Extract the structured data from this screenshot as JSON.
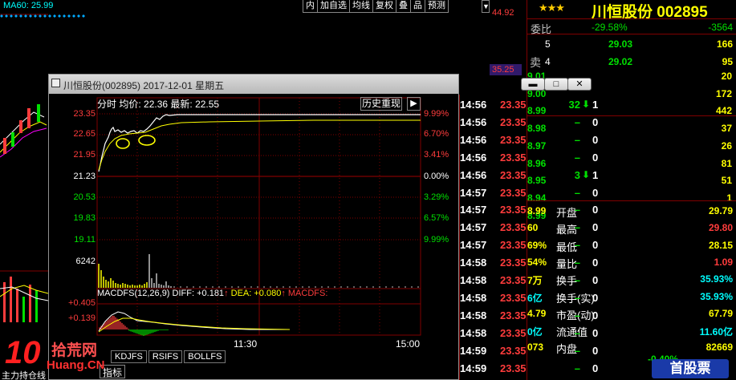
{
  "top": {
    "ma60": "MA60: 25.99",
    "toolbar": [
      "内",
      "加自选",
      "均线",
      "复权",
      "叠",
      "品",
      "预测"
    ],
    "axis_price_top": "44.92",
    "axis_price_mid": "35.25"
  },
  "quote": {
    "stars": "★★★",
    "title": "川恒股份 002895",
    "weibi_label": "委比",
    "weibi_pct": "-29.58%",
    "weibi_num": "-3564",
    "sell_label": "卖",
    "sell_orders": [
      {
        "level": "5",
        "price": "29.03",
        "vol": "166"
      },
      {
        "level": "4",
        "price": "29.02",
        "vol": "95"
      }
    ],
    "right_vols": [
      "20",
      "172",
      "442",
      "37",
      "26",
      "81",
      "51",
      "1"
    ],
    "right_prices_frag": [
      "9.01",
      "9.00",
      "8.99",
      "8.98",
      "8.97",
      "8.96",
      "8.95",
      "8.94",
      "8.99"
    ],
    "stats": [
      {
        "label": "开盘",
        "value": "29.79",
        "color": "#ffff00",
        "left_frag": "8.99"
      },
      {
        "label": "最高",
        "value": "29.80",
        "color": "#ff3c3c",
        "left_frag": "60"
      },
      {
        "label": "最低",
        "value": "28.15",
        "color": "#ffff00",
        "left_frag": "69%"
      },
      {
        "label": "量比",
        "value": "1.09",
        "color": "#ff3c3c",
        "left_frag": "54%"
      },
      {
        "label": "换手",
        "value": "35.93%",
        "color": "#00ffff",
        "left_frag": "7万"
      },
      {
        "label": "换手(实)",
        "value": "35.93%",
        "color": "#00ffff",
        "left_frag": "6亿"
      },
      {
        "label": "市盈(动)",
        "value": "67.79",
        "color": "#ffff00",
        "left_frag": "4.79"
      },
      {
        "label": "流通值",
        "value": "11.60亿",
        "color": "#00ffff",
        "left_frag": "0亿"
      },
      {
        "label": "内盘",
        "value": "82669",
        "color": "#ffff00",
        "left_frag": "073"
      }
    ],
    "bottom_pct": "-0.40%"
  },
  "window": {
    "title": "川恒股份(002895) 2017-12-01 星期五",
    "ctrl_min": "▬",
    "ctrl_max": "□",
    "ctrl_close": "✕",
    "head_fenshi": "分时",
    "head_avg": "均价: 22.36",
    "head_last": "最新: 22.55",
    "history_btn": "历史重现",
    "history_arrow": "▶",
    "y_left": [
      "23.35",
      "22.65",
      "21.95",
      "21.23",
      "20.53",
      "19.83",
      "19.11"
    ],
    "y_right": [
      "9.99%",
      "6.70%",
      "3.41%",
      "0.00%",
      "3.29%",
      "6.57%",
      "9.99%"
    ],
    "vol_label": "6242",
    "macd_label": "MACDFS(12,26,9)",
    "macd_diff": "DIFF: +0.181",
    "macd_dea": "DEA: +0.080",
    "macd_name": "MACDFS:",
    "macd_y1": "+0.405",
    "macd_y2": "+0.139",
    "x_mid": "11:30",
    "x_end": "15:00"
  },
  "ticks": [
    {
      "time": "14:56",
      "price": "23.35",
      "vol": "32",
      "arrow": "down",
      "n": "1"
    },
    {
      "time": "14:56",
      "price": "23.35",
      "vol": "–",
      "arrow": "",
      "n": "0"
    },
    {
      "time": "14:56",
      "price": "23.35",
      "vol": "–",
      "arrow": "",
      "n": "0"
    },
    {
      "time": "14:56",
      "price": "23.35",
      "vol": "–",
      "arrow": "",
      "n": "0"
    },
    {
      "time": "14:56",
      "price": "23.35",
      "vol": "3",
      "arrow": "down",
      "n": "1"
    },
    {
      "time": "14:57",
      "price": "23.35",
      "vol": "–",
      "arrow": "",
      "n": "0"
    },
    {
      "time": "14:57",
      "price": "23.35",
      "vol": "–",
      "arrow": "",
      "n": "0"
    },
    {
      "time": "14:57",
      "price": "23.35",
      "vol": "–",
      "arrow": "",
      "n": "0"
    },
    {
      "time": "14:57",
      "price": "23.35",
      "vol": "–",
      "arrow": "",
      "n": "0"
    },
    {
      "time": "14:58",
      "price": "23.35",
      "vol": "–",
      "arrow": "",
      "n": "0"
    },
    {
      "time": "14:58",
      "price": "23.35",
      "vol": "–",
      "arrow": "",
      "n": "0"
    },
    {
      "time": "14:58",
      "price": "23.35",
      "vol": "–",
      "arrow": "",
      "n": "0"
    },
    {
      "time": "14:58",
      "price": "23.35",
      "vol": "–",
      "arrow": "",
      "n": "0"
    },
    {
      "time": "14:58",
      "price": "23.35",
      "vol": "–",
      "arrow": "",
      "n": "0"
    },
    {
      "time": "14:59",
      "price": "23.35",
      "vol": "–",
      "arrow": "",
      "n": "0"
    },
    {
      "time": "14:59",
      "price": "23.35",
      "vol": "–",
      "arrow": "",
      "n": "0"
    }
  ],
  "bottom": {
    "tabs": [
      "KDJFS",
      "RSIFS",
      "BOLLFS"
    ],
    "zhibiao": "指标",
    "watermark_logo": "10",
    "watermark_text": "拾荒网",
    "watermark_url": "Huang.CN",
    "watermark_right": "首股票",
    "side_frag": "主力持仓线"
  },
  "colors": {
    "up": "#ff3c3c",
    "down": "#00e000",
    "price_line": "#ffffff",
    "avg_line": "#ffff00",
    "grid": "#800000"
  }
}
